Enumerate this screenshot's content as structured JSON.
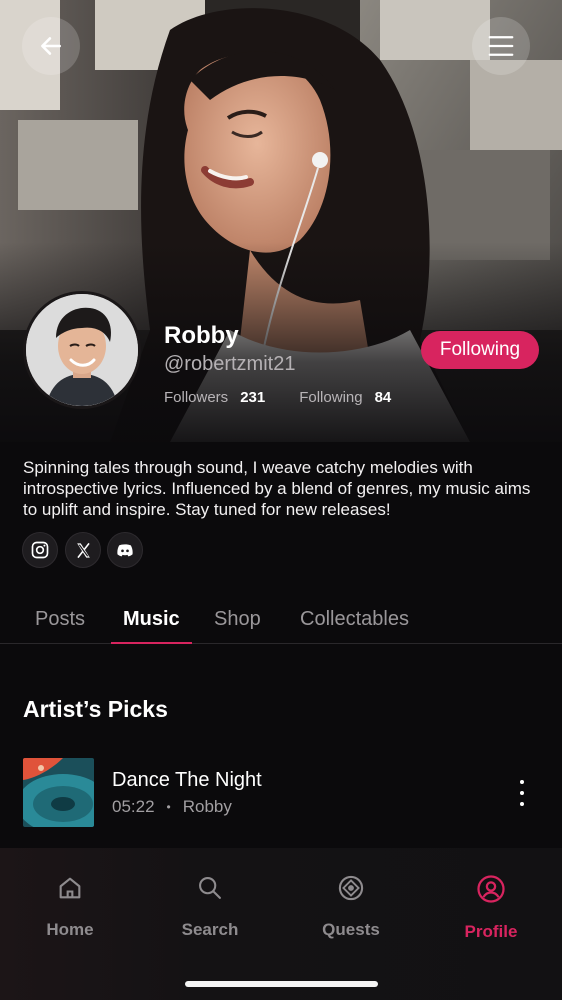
{
  "header": {
    "back_icon": "arrow-left-icon",
    "menu_icon": "hamburger-menu-icon"
  },
  "profile": {
    "name": "Robby",
    "handle": "@robertzmit21",
    "followers_label": "Followers",
    "followers_count": "231",
    "following_label": "Following",
    "following_count": "84",
    "follow_button_label": "Following",
    "bio": "Spinning tales through sound, I weave catchy melodies with introspective lyrics. Influenced by a blend of genres, my music aims to uplift and inspire. Stay tuned for new releases!",
    "social": [
      "instagram-icon",
      "x-icon",
      "discord-icon"
    ]
  },
  "tabs": [
    {
      "label": "Posts",
      "active": false
    },
    {
      "label": "Music",
      "active": true
    },
    {
      "label": "Shop",
      "active": false
    },
    {
      "label": "Collectables",
      "active": false
    }
  ],
  "section": {
    "title": "Artist’s Picks"
  },
  "tracks": [
    {
      "title": "Dance The Night",
      "duration": "05:22",
      "artist": "Robby"
    }
  ],
  "nav": [
    {
      "label": "Home",
      "icon": "home-icon",
      "active": false
    },
    {
      "label": "Search",
      "icon": "search-icon",
      "active": false
    },
    {
      "label": "Quests",
      "icon": "quests-icon",
      "active": false
    },
    {
      "label": "Profile",
      "icon": "profile-icon",
      "active": true
    }
  ],
  "colors": {
    "accent": "#d8245f",
    "background": "#0b0a0c"
  }
}
